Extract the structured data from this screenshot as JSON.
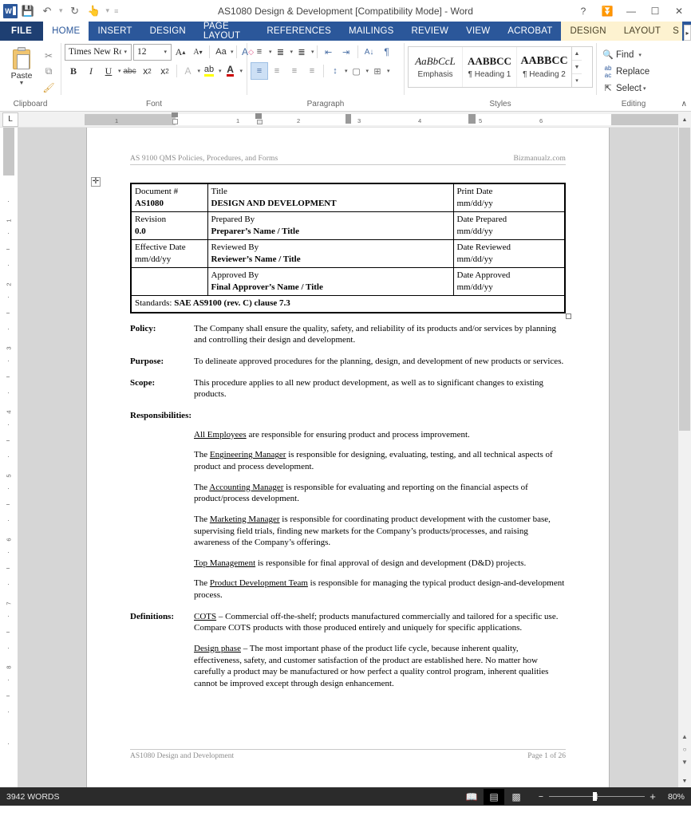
{
  "window": {
    "title": "AS1080 Design & Development [Compatibility Mode] - Word",
    "quick_access": [
      {
        "name": "save",
        "glyph": "💾"
      },
      {
        "name": "undo",
        "glyph": "↶"
      },
      {
        "name": "redo",
        "glyph": "↻"
      },
      {
        "name": "touch-mode",
        "glyph": "👆"
      },
      {
        "name": "customize",
        "glyph": "≡"
      }
    ],
    "controls": {
      "help": "?",
      "ribbon_display": "⤒",
      "minimize": "—",
      "restore": "❐",
      "close": "✕"
    }
  },
  "tabs": {
    "file": "FILE",
    "items": [
      {
        "label": "HOME",
        "state": "active"
      },
      {
        "label": "INSERT",
        "state": "normal"
      },
      {
        "label": "DESIGN",
        "state": "normal"
      },
      {
        "label": "PAGE LAYOUT",
        "state": "normal"
      },
      {
        "label": "REFERENCES",
        "state": "normal"
      },
      {
        "label": "MAILINGS",
        "state": "normal"
      },
      {
        "label": "REVIEW",
        "state": "normal"
      },
      {
        "label": "VIEW",
        "state": "normal"
      },
      {
        "label": "ACROBAT",
        "state": "normal"
      },
      {
        "label": "DESIGN",
        "state": "contextual"
      },
      {
        "label": "LAYOUT",
        "state": "contextual"
      },
      {
        "label": "S",
        "state": "contextual-partial"
      }
    ],
    "overflow_arrow": "▸"
  },
  "ribbon": {
    "groups": [
      {
        "name": "clipboard",
        "label": "Clipboard"
      },
      {
        "name": "font",
        "label": "Font"
      },
      {
        "name": "paragraph",
        "label": "Paragraph"
      },
      {
        "name": "styles",
        "label": "Styles"
      },
      {
        "name": "editing",
        "label": "Editing"
      }
    ],
    "clipboard": {
      "paste_label": "Paste",
      "paste_arrow": "▼",
      "cut": "✂",
      "copy": "⧉",
      "format_painter": "🖌"
    },
    "font": {
      "font_name": "Times New Ro",
      "font_size": "12",
      "grow": "A",
      "shrink": "A",
      "change_case": "Aa",
      "clear_formatting": "A",
      "bold": "B",
      "italic": "I",
      "underline": "U",
      "strikethrough": "abc",
      "subscript": "x",
      "subscript_index": "2",
      "superscript": "x",
      "superscript_index": "2",
      "text_effects": "A",
      "highlight": "ab",
      "font_color": "A",
      "dropdown": "▾"
    },
    "paragraph": {
      "bullets": "bullet-list",
      "numbering": "numbered-list",
      "multilevel": "multilevel-list",
      "decrease_indent": "⬅",
      "increase_indent": "➡",
      "sort": "A↓",
      "show_marks": "¶",
      "align_left": "≡",
      "align_center": "≡",
      "align_right": "≡",
      "justify": "≡",
      "line_spacing": "↕",
      "shading": "🪣",
      "borders": "⊞",
      "dropdown": "▾"
    },
    "styles": {
      "items": [
        {
          "preview": "AaBbCcL",
          "name": "Emphasis",
          "style": "italic-serif"
        },
        {
          "preview": "AABBCC",
          "name": "¶ Heading 1",
          "style": "bold-serif"
        },
        {
          "preview": "AABBCC",
          "name": "¶ Heading 2",
          "style": "bold-serif-large"
        }
      ],
      "scroll_up": "▲",
      "scroll_down": "▼",
      "more": "▾"
    },
    "editing": {
      "find": "Find",
      "find_icon": "🔍",
      "find_arrow": "▾",
      "replace": "Replace",
      "replace_icon": "ab",
      "select": "Select",
      "select_icon": "↖",
      "select_arrow": "▾"
    },
    "collapse_icon": "∧",
    "dialog_launcher": "⤡"
  },
  "ruler": {
    "tab_stop_selector": "L",
    "horizontal_labels": [
      "1",
      "1",
      "2",
      "3",
      "4",
      "5",
      "6"
    ],
    "vertical_labels": [
      "1",
      "2",
      "3",
      "4",
      "5",
      "6",
      "7",
      "8"
    ]
  },
  "document": {
    "header": {
      "left": "AS 9100 QMS Policies, Procedures, and Forms",
      "right": "Bizmanualz.com"
    },
    "table": {
      "handle_icon": "✛",
      "rows": [
        [
          {
            "label": "Document #",
            "value": "AS1080"
          },
          {
            "label": "Title",
            "value": "DESIGN AND DEVELOPMENT"
          },
          {
            "label": "Print Date",
            "value": "mm/dd/yy",
            "bold": false
          }
        ],
        [
          {
            "label": "Revision",
            "value": "0.0"
          },
          {
            "label": "Prepared By",
            "value": "Preparer’s Name / Title"
          },
          {
            "label": "Date Prepared",
            "value": "mm/dd/yy",
            "bold": false
          }
        ],
        [
          {
            "label": "Effective Date",
            "value": "mm/dd/yy",
            "bold": false
          },
          {
            "label": "Reviewed By",
            "value": "Reviewer’s Name / Title"
          },
          {
            "label": "Date Reviewed",
            "value": "mm/dd/yy",
            "bold": false
          }
        ],
        [
          {
            "label": "",
            "value": ""
          },
          {
            "label": "Approved By",
            "value": "Final Approver’s Name / Title"
          },
          {
            "label": "Date Approved",
            "value": "mm/dd/yy",
            "bold": false
          }
        ]
      ],
      "standards_label": "Standards:",
      "standards_value": "SAE AS9100 (rev. C) clause 7.3"
    },
    "sections": [
      {
        "key": "Policy:",
        "text": "The Company shall ensure the quality, safety, and reliability of its products and/or services by planning and controlling their design and development."
      },
      {
        "key": "Purpose:",
        "text": "To delineate approved procedures for the planning, design, and development of new products or services."
      },
      {
        "key": "Scope:",
        "text": "This procedure applies to all new product development, as well as to significant changes to existing products."
      }
    ],
    "responsibilities": {
      "heading": "Responsibilities:",
      "items": [
        {
          "pre": "",
          "term": "All Employees",
          "post": " are responsible for ensuring product and process improvement."
        },
        {
          "pre": "The ",
          "term": "Engineering Manager",
          "post": " is responsible for designing, evaluating, testing, and all technical aspects of product and process development."
        },
        {
          "pre": "The ",
          "term": "Accounting Manager",
          "post": " is responsible for evaluating and reporting on the financial aspects of product/process development."
        },
        {
          "pre": "The ",
          "term": "Marketing Manager",
          "post": " is responsible for coordinating product development with the customer base, supervising field trials, finding new markets for the Company’s products/processes, and raising awareness of the Company’s offerings."
        },
        {
          "pre": "",
          "term": "Top Management",
          "post": " is responsible for final approval of design and development (D&D) projects."
        },
        {
          "pre": "The ",
          "term": "Product Development Team",
          "post": " is responsible for managing the typical product design-and-development process."
        }
      ]
    },
    "definitions": {
      "key": "Definitions:",
      "items": [
        {
          "term": "COTS",
          "post": " – Commercial off-the-shelf; products manufactured commercially and tailored for a specific use.  Compare COTS products with those produced entirely and uniquely for specific applications."
        },
        {
          "term": "Design phase",
          "post": " – The most important phase of the product life cycle, because inherent quality, effectiveness, safety, and customer satisfaction of the product are established here.  No matter how carefully a product may be manufactured or how perfect a quality control program, inherent qualities cannot be improved except through design enhancement."
        }
      ]
    },
    "footer": {
      "left": "AS1080 Design and Development",
      "right": "Page 1 of 26"
    }
  },
  "status_bar": {
    "word_count": "3942 WORDS",
    "views": [
      {
        "name": "read-mode",
        "glyph": "📖",
        "selected": false
      },
      {
        "name": "print-layout",
        "glyph": "▤",
        "selected": true
      },
      {
        "name": "web-layout",
        "glyph": "▥",
        "selected": false
      }
    ],
    "zoom_out": "−",
    "zoom_in": "+",
    "zoom_level": "80%"
  }
}
